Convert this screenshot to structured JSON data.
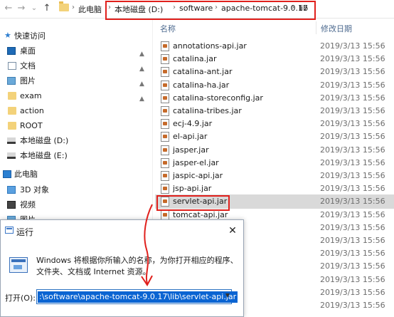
{
  "address_bar": {
    "nav_back": "←",
    "nav_forward": "→",
    "nav_recent": "⌄",
    "nav_up": "↑",
    "crumbs": [
      "此电脑",
      "本地磁盘 (D:)",
      "software",
      "apache-tomcat-9.0.17",
      "lib"
    ],
    "separator": "›"
  },
  "sidebar": {
    "quick_access": "快速访问",
    "pinned": [
      {
        "label": "桌面",
        "icon": "desktop-icon"
      },
      {
        "label": "文档",
        "icon": "document-icon"
      },
      {
        "label": "图片",
        "icon": "picture-icon"
      },
      {
        "label": "exam",
        "icon": "folder-icon"
      }
    ],
    "folders": [
      {
        "label": "action",
        "icon": "folder-icon"
      },
      {
        "label": "ROOT",
        "icon": "folder-icon"
      }
    ],
    "drives": [
      {
        "label": "本地磁盘 (D:)",
        "icon": "drive-icon"
      },
      {
        "label": "本地磁盘 (E:)",
        "icon": "drive-icon"
      }
    ],
    "this_pc": "此电脑",
    "pc_items": [
      {
        "label": "3D 对象",
        "icon": "3d-objects-icon"
      },
      {
        "label": "视频",
        "icon": "video-icon"
      },
      {
        "label": "图片",
        "icon": "picture-icon"
      }
    ],
    "pin_glyph": "📌"
  },
  "file_list": {
    "col_name": "名称",
    "col_date": "修改日期",
    "files": [
      {
        "name": "annotations-api.jar",
        "date": "2019/3/13 15:56"
      },
      {
        "name": "catalina.jar",
        "date": "2019/3/13 15:56"
      },
      {
        "name": "catalina-ant.jar",
        "date": "2019/3/13 15:56"
      },
      {
        "name": "catalina-ha.jar",
        "date": "2019/3/13 15:56"
      },
      {
        "name": "catalina-storeconfig.jar",
        "date": "2019/3/13 15:56"
      },
      {
        "name": "catalina-tribes.jar",
        "date": "2019/3/13 15:56"
      },
      {
        "name": "ecj-4.9.jar",
        "date": "2019/3/13 15:56"
      },
      {
        "name": "el-api.jar",
        "date": "2019/3/13 15:56"
      },
      {
        "name": "jasper.jar",
        "date": "2019/3/13 15:56"
      },
      {
        "name": "jasper-el.jar",
        "date": "2019/3/13 15:56"
      },
      {
        "name": "jaspic-api.jar",
        "date": "2019/3/13 15:56"
      },
      {
        "name": "jsp-api.jar",
        "date": "2019/3/13 15:56"
      },
      {
        "name": "servlet-api.jar",
        "date": "2019/3/13 15:56"
      },
      {
        "name": "tomcat-api.jar",
        "date": "2019/3/13 15:56"
      }
    ],
    "extra_dates": [
      "2019/3/13 15:56",
      "2019/3/13 15:56",
      "2019/3/13 15:56",
      "2019/3/13 15:56",
      "2019/3/13 15:56",
      "2019/3/13 15:56",
      "2019/3/13 15:56"
    ],
    "selected_index": 12
  },
  "run_dialog": {
    "title": "运行",
    "close": "✕",
    "description_line1": "Windows 将根据你所输入的名称，为你打开相应的程序、",
    "description_line2": "文件夹、文档或 Internet 资源。",
    "open_label": "打开(O):",
    "open_value": ":\\software\\apache-tomcat-9.0.17\\lib\\servlet-api.jar",
    "dropdown_glyph": "▼"
  },
  "colors": {
    "highlight_red": "#e0201c",
    "selection_gray": "#d9d9d9",
    "input_selection": "#0a64d2"
  }
}
